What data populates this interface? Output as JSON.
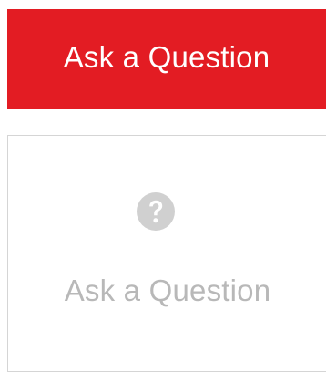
{
  "primary_button": {
    "label": "Ask a Question",
    "background_color": "#e31c23",
    "text_color": "#ffffff"
  },
  "card": {
    "icon": "question-circle-icon",
    "icon_color": "#d0d0d0",
    "label": "Ask a Question",
    "text_color": "#b8b8b8",
    "border_color": "#d5d5d5"
  }
}
